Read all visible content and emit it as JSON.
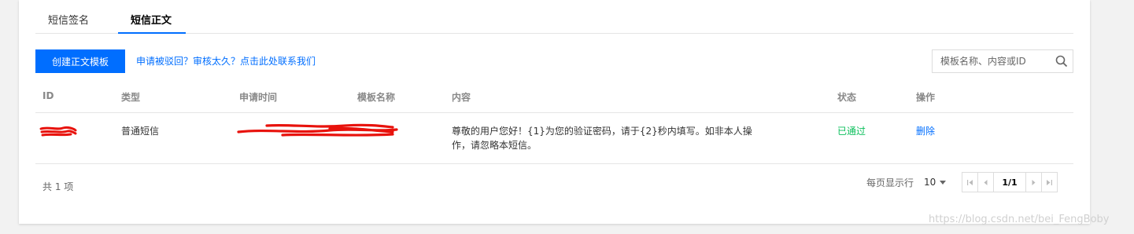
{
  "tabs": [
    {
      "label": "短信签名",
      "active": false
    },
    {
      "label": "短信正文",
      "active": true
    }
  ],
  "toolbar": {
    "create_label": "创建正文模板",
    "contact_link": "申请被驳回？审核太久？点击此处联系我们"
  },
  "search": {
    "placeholder": "模板名称、内容或ID"
  },
  "table": {
    "headers": {
      "id": "ID",
      "type": "类型",
      "time": "申请时间",
      "name": "模板名称",
      "content": "内容",
      "status": "状态",
      "action": "操作"
    },
    "rows": [
      {
        "type": "普通短信",
        "content": "尊敬的用户您好！{1}为您的验证密码，请于{2}秒内填写。如非本人操作，请忽略本短信。",
        "status": "已通过",
        "action": "删除"
      }
    ]
  },
  "footer": {
    "total": "共 1 项",
    "page_size_label": "每页显示行",
    "page_size": "10",
    "page_indicator": "1/1"
  },
  "watermark": "https://blog.csdn.net/bei_FengBoby",
  "colors": {
    "accent": "#006eff",
    "success": "#0abf5b",
    "redaction": "#e8120c"
  }
}
